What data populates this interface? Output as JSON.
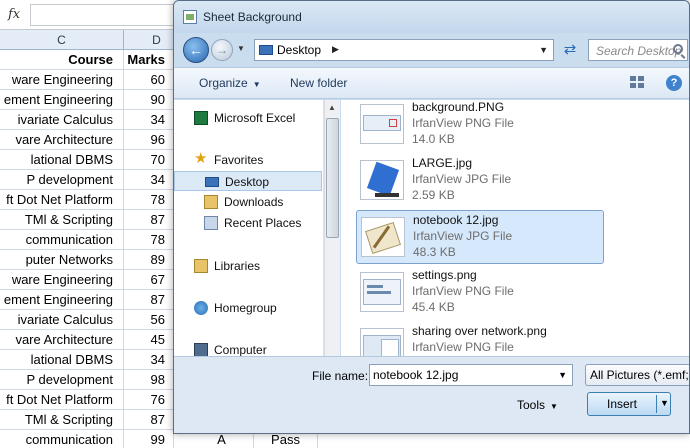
{
  "sheet": {
    "fx_label": "fx",
    "columns": [
      "C",
      "D"
    ],
    "header": {
      "course": "Course",
      "marks": "Marks"
    },
    "rows": [
      {
        "course": "ware Engineering",
        "marks": "60"
      },
      {
        "course": "ement Engineering",
        "marks": "90"
      },
      {
        "course": "ivariate Calculus",
        "marks": "34"
      },
      {
        "course": "vare Architecture",
        "marks": "96"
      },
      {
        "course": "lational DBMS",
        "marks": "70"
      },
      {
        "course": "P development",
        "marks": "34"
      },
      {
        "course": "ft Dot Net Platform",
        "marks": "78"
      },
      {
        "course": "TMl & Scripting",
        "marks": "87"
      },
      {
        "course": "communication",
        "marks": "78"
      },
      {
        "course": "puter Networks",
        "marks": "89"
      },
      {
        "course": "ware Engineering",
        "marks": "67"
      },
      {
        "course": "ement Engineering",
        "marks": "87"
      },
      {
        "course": "ivariate Calculus",
        "marks": "56"
      },
      {
        "course": "vare Architecture",
        "marks": "45"
      },
      {
        "course": "lational DBMS",
        "marks": "34"
      },
      {
        "course": "P development",
        "marks": "98"
      },
      {
        "course": "ft Dot Net Platform",
        "marks": "76"
      },
      {
        "course": "TMl & Scripting",
        "marks": "87"
      },
      {
        "course": "communication",
        "marks": "99",
        "grade": "A",
        "status": "Pass"
      }
    ]
  },
  "dialog": {
    "title": "Sheet Background",
    "address": "Desktop",
    "search_placeholder": "Search Desktop",
    "toolbar": {
      "organize": "Organize",
      "new_folder": "New folder"
    },
    "nav": [
      {
        "label": "Microsoft Excel",
        "icon": "excel-icon"
      },
      {
        "label": "Favorites",
        "icon": "star-icon"
      },
      {
        "label": "Desktop",
        "icon": "desktop-icon",
        "selected": true
      },
      {
        "label": "Downloads",
        "icon": "downloads-icon"
      },
      {
        "label": "Recent Places",
        "icon": "recent-places-icon"
      },
      {
        "label": "Libraries",
        "icon": "libraries-icon"
      },
      {
        "label": "Homegroup",
        "icon": "homegroup-icon"
      },
      {
        "label": "Computer",
        "icon": "computer-icon"
      }
    ],
    "files": [
      {
        "name": "background.PNG",
        "type": "IrfanView PNG File",
        "size": "14.0 KB"
      },
      {
        "name": "LARGE.jpg",
        "type": "IrfanView JPG File",
        "size": "2.59 KB"
      },
      {
        "name": "notebook 12.jpg",
        "type": "IrfanView JPG File",
        "size": "48.3 KB",
        "selected": true
      },
      {
        "name": "settings.png",
        "type": "IrfanView PNG File",
        "size": "45.4 KB"
      },
      {
        "name": "sharing over network.png",
        "type": "IrfanView PNG File",
        "size": ""
      }
    ],
    "file_name_label": "File name:",
    "file_name_value": "notebook 12.jpg",
    "filter": "All Pictures (*.emf;*.wmf;*.jpg)",
    "tools": "Tools",
    "insert": "Insert"
  }
}
